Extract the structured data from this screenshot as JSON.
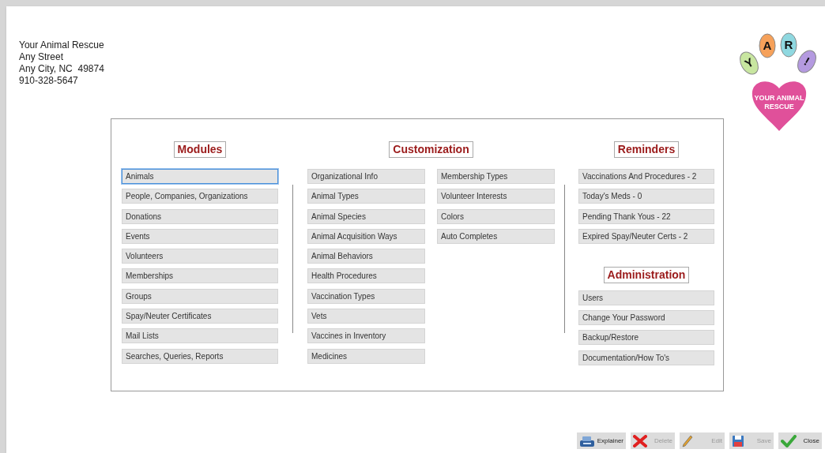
{
  "address": [
    "Your Animal Rescue",
    "Any Street",
    "Any City, NC  49874",
    "910-328-5647"
  ],
  "logo": {
    "letters": [
      "Y",
      "A",
      "R",
      "!"
    ],
    "caption_lines": [
      "YOUR ANIMAL",
      "RESCUE"
    ]
  },
  "modules": {
    "title": "Modules",
    "items": [
      {
        "label": "Animals",
        "selected": true
      },
      {
        "label": "People, Companies, Organizations",
        "selected": false
      },
      {
        "label": "Donations",
        "selected": false
      },
      {
        "label": "Events",
        "selected": false
      },
      {
        "label": "Volunteers",
        "selected": false
      },
      {
        "label": "Memberships",
        "selected": false
      },
      {
        "label": "Groups",
        "selected": false
      },
      {
        "label": "Spay/Neuter Certificates",
        "selected": false
      },
      {
        "label": "Mail Lists",
        "selected": false
      },
      {
        "label": "Searches, Queries, Reports",
        "selected": false
      }
    ]
  },
  "customization": {
    "title": "Customization",
    "columns": [
      [
        "Organizational Info",
        "Animal Types",
        "Animal Species",
        "Animal Acquisition Ways",
        "Animal Behaviors",
        "Health Procedures",
        "Vaccination Types",
        "Vets",
        "Vaccines in Inventory",
        "Medicines"
      ],
      [
        "Membership Types",
        "Volunteer Interests",
        "Colors",
        "Auto Completes"
      ]
    ]
  },
  "reminders": {
    "title": "Reminders",
    "items": [
      "Vaccinations And Procedures - 2",
      "Today's Meds - 0",
      "Pending Thank Yous - 22",
      "Expired Spay/Neuter Certs - 2"
    ]
  },
  "administration": {
    "title": "Administration",
    "items": [
      "Users",
      "Change Your Password",
      "Backup/Restore",
      "Documentation/How To's"
    ]
  },
  "toolbar": [
    {
      "kind": "explainer",
      "label": "Explainer",
      "disabled": false
    },
    {
      "kind": "delete",
      "label": "Delete",
      "disabled": true
    },
    {
      "kind": "edit",
      "label": "Edit",
      "disabled": true
    },
    {
      "kind": "save",
      "label": "Save",
      "disabled": true
    },
    {
      "kind": "close",
      "label": "Close",
      "disabled": false
    }
  ]
}
